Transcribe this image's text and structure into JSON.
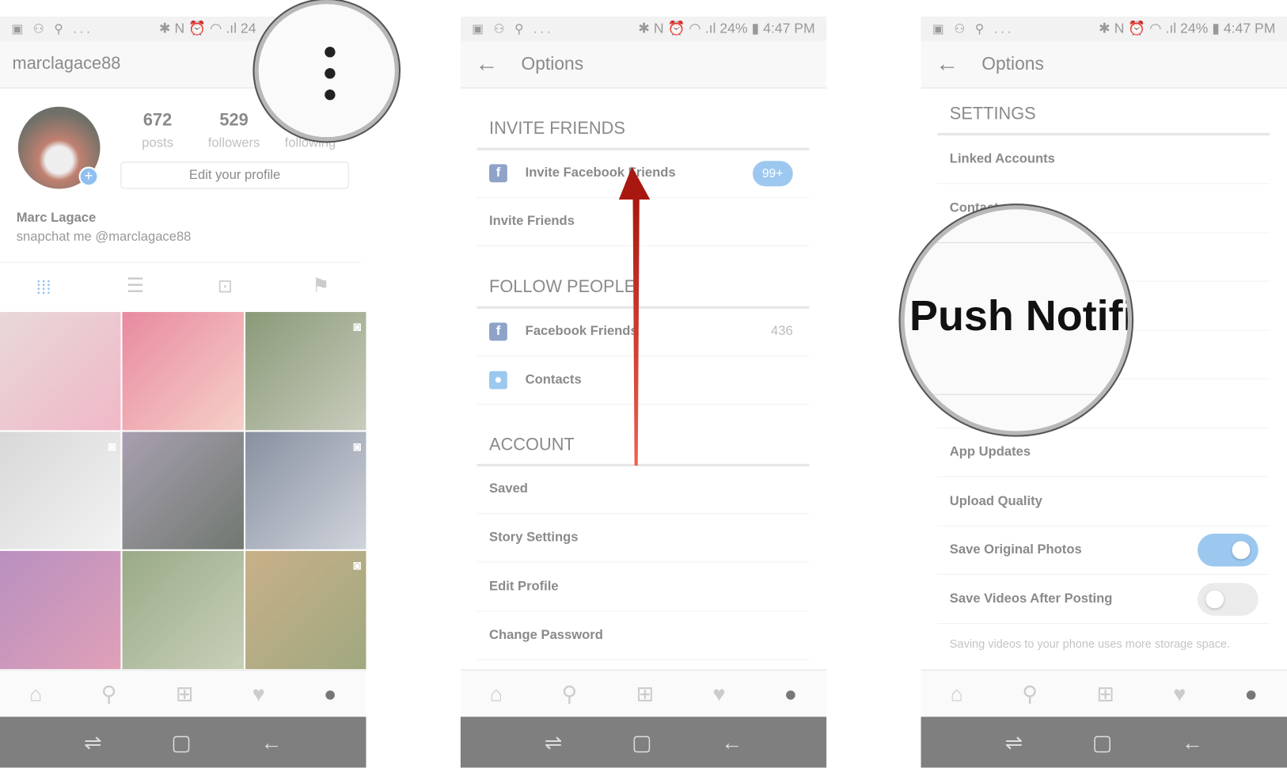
{
  "status": {
    "left_icons": "▣ ⚇ ⚲ ...",
    "right": "✱ N ⏰ ◠ .ıl 24% ▮ 4:47 PM",
    "right_partial": "✱ N ⏰ ◠ .ıl 24"
  },
  "profile": {
    "username": "marclagace88",
    "stats": [
      {
        "value": "672",
        "label": "posts"
      },
      {
        "value": "529",
        "label": "followers"
      },
      {
        "value": "",
        "label": "following"
      }
    ],
    "edit_button": "Edit your profile",
    "name": "Marc Lagace",
    "bio": "snapchat me @marclagace88",
    "tabs": [
      "grid-icon",
      "list-icon",
      "tagged-icon",
      "bookmark-icon"
    ],
    "photos": [
      {
        "colors": [
          "#e8d8d8",
          "#f0b8c8"
        ],
        "video": false
      },
      {
        "colors": [
          "#e88aa0",
          "#f6d0c8"
        ],
        "video": false
      },
      {
        "colors": [
          "#8a9a78",
          "#c8ccbc"
        ],
        "video": true
      },
      {
        "colors": [
          "#d8d8d8",
          "#f2f2f2"
        ],
        "video": true
      },
      {
        "colors": [
          "#a8a0b0",
          "#707870"
        ],
        "video": false
      },
      {
        "colors": [
          "#8890a0",
          "#d0d4dc"
        ],
        "video": true
      },
      {
        "colors": [
          "#b890c0",
          "#e0a0b8"
        ],
        "video": false
      },
      {
        "colors": [
          "#9aaa88",
          "#c8d0b8"
        ],
        "video": false
      },
      {
        "colors": [
          "#c8b088",
          "#a0a880"
        ],
        "video": true
      }
    ]
  },
  "options_title": "Options",
  "options": {
    "sections": [
      {
        "title": "INVITE FRIENDS",
        "rows": [
          {
            "label": "Invite Facebook Friends",
            "icon": "facebook-icon",
            "badge": "99+"
          },
          {
            "label": "Invite Friends"
          }
        ]
      },
      {
        "title": "FOLLOW PEOPLE",
        "rows": [
          {
            "label": "Facebook Friends",
            "icon": "facebook-icon",
            "count": "436"
          },
          {
            "label": "Contacts",
            "icon": "contacts-icon"
          }
        ]
      },
      {
        "title": "ACCOUNT",
        "rows": [
          {
            "label": "Saved"
          },
          {
            "label": "Story Settings"
          },
          {
            "label": "Edit Profile"
          },
          {
            "label": "Change Password"
          }
        ]
      }
    ]
  },
  "settings": {
    "title": "SETTINGS",
    "rows": [
      {
        "label": "Linked Accounts"
      },
      {
        "label": "Contacts"
      },
      {
        "label": ""
      },
      {
        "label": ""
      },
      {
        "label": ""
      },
      {
        "label": ""
      },
      {
        "label": "App Updates"
      },
      {
        "label": "Upload Quality"
      },
      {
        "label": "Save Original Photos",
        "toggle": true
      },
      {
        "label": "Save Videos After Posting",
        "toggle": false
      }
    ],
    "caption": "Saving videos to your phone uses more storage space.",
    "magnified_text": "Push Notifi"
  },
  "colors": {
    "accent": "#9cc8f0",
    "arrow": "#c0201a",
    "facebook": "#8fa3c8"
  }
}
